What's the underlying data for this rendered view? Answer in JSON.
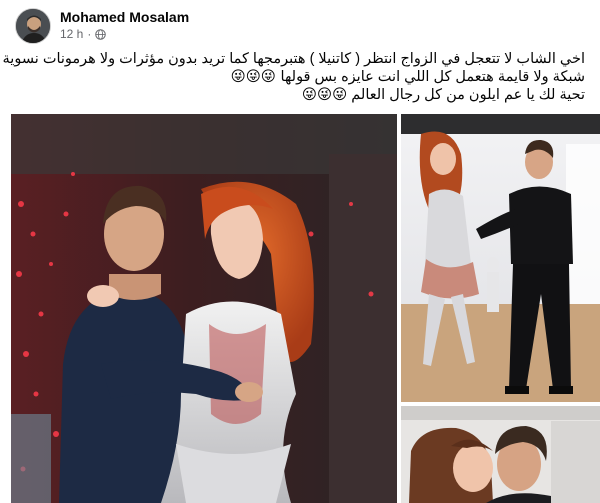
{
  "post": {
    "author": {
      "name": "Mohamed Mosalam",
      "avatar_icon": "profile-photo"
    },
    "timestamp": "12 h",
    "separator": "·",
    "audience_icon": "globe-icon",
    "text_lines": [
      "اخي الشاب لا تتعجل في الزواج انتظر ( كاتنيلا ) هتبرمجها كما تريد بدون مؤثرات ولا هرمونات نسوية و لا",
      "شبكة ولا قايمة هتعمل كل اللي انت عايزه بس قولها",
      "تحية لك يا عم ايلون من كل رجال العالم"
    ],
    "emojis_line_2": "😜😜😜",
    "emojis_line_3": "😜😜😜",
    "photos": [
      {
        "subject": "man and red-haired robot woman dancing"
      },
      {
        "subject": "man and robot woman dancing in studio"
      },
      {
        "subject": "man and woman kissing"
      }
    ]
  },
  "colors": {
    "text": "#050505",
    "secondary_text": "#65676b",
    "background": "#ffffff"
  }
}
